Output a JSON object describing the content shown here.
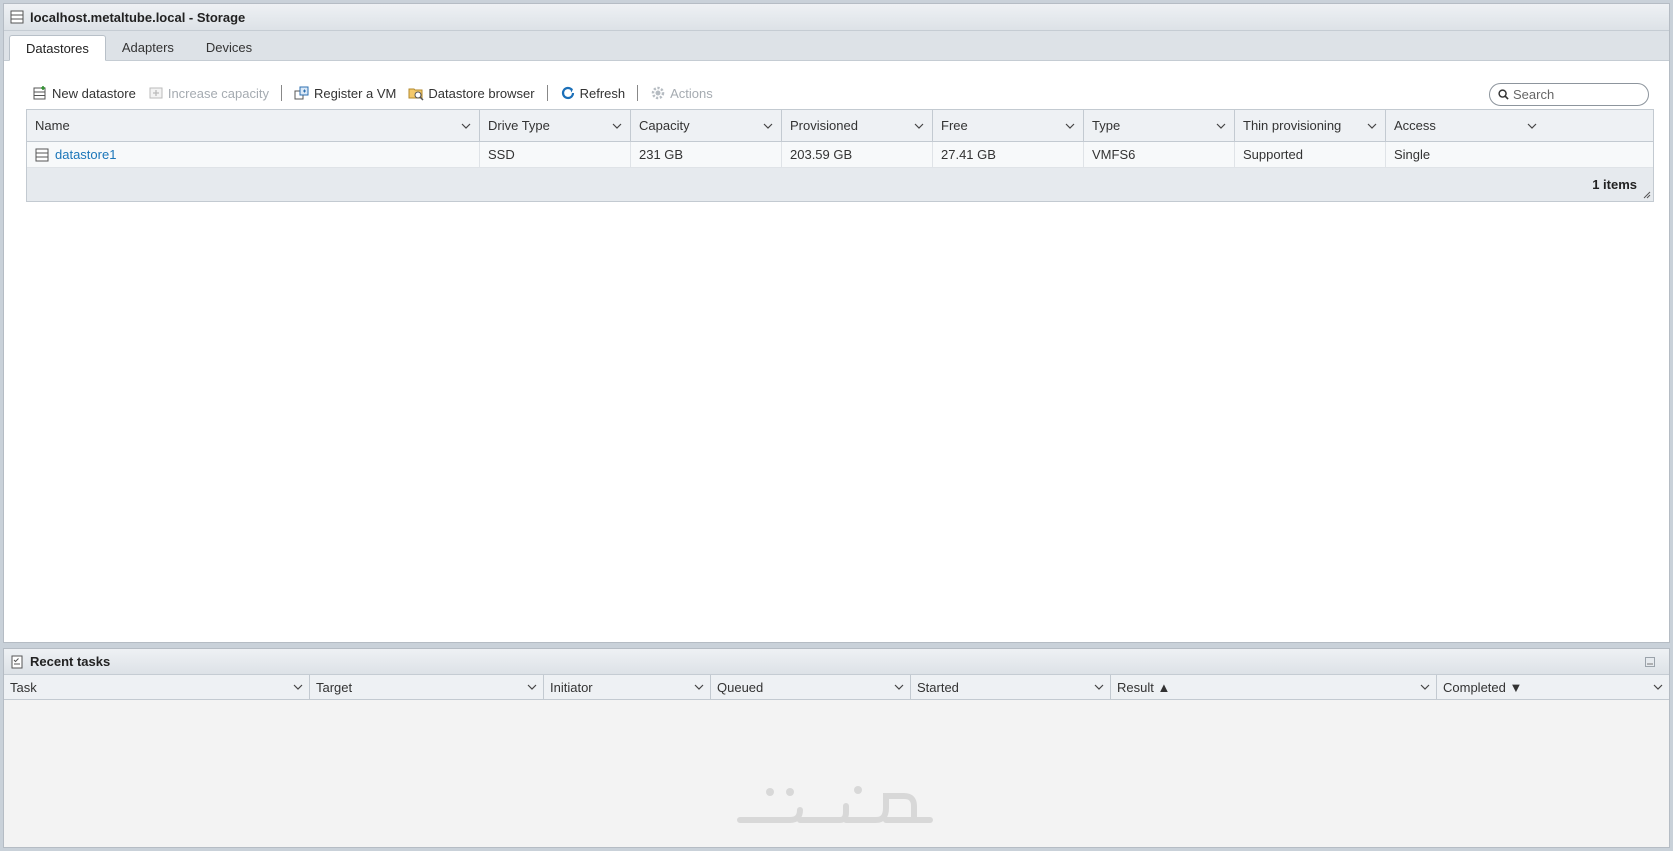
{
  "window": {
    "title": "localhost.metaltube.local - Storage"
  },
  "tabs": [
    {
      "label": "Datastores",
      "active": true
    },
    {
      "label": "Adapters",
      "active": false
    },
    {
      "label": "Devices",
      "active": false
    }
  ],
  "toolbar": {
    "new_datastore": "New datastore",
    "increase_capacity": "Increase capacity",
    "register_vm": "Register a VM",
    "datastore_browser": "Datastore browser",
    "refresh": "Refresh",
    "actions": "Actions"
  },
  "search": {
    "placeholder": "Search"
  },
  "datastores": {
    "columns": [
      "Name",
      "Drive Type",
      "Capacity",
      "Provisioned",
      "Free",
      "Type",
      "Thin provisioning",
      "Access"
    ],
    "rows": [
      {
        "name": "datastore1",
        "drive_type": "SSD",
        "capacity": "231 GB",
        "provisioned": "203.59 GB",
        "free": "27.41 GB",
        "type": "VMFS6",
        "thin": "Supported",
        "access": "Single"
      }
    ],
    "footer": "1 items"
  },
  "recent_tasks": {
    "title": "Recent tasks",
    "columns": [
      "Task",
      "Target",
      "Initiator",
      "Queued",
      "Started",
      "Result ▲",
      "Completed ▼"
    ]
  },
  "colors": {
    "link": "#1b76b9",
    "header_bg": "#eef1f4",
    "disabled": "#a5abb1"
  }
}
